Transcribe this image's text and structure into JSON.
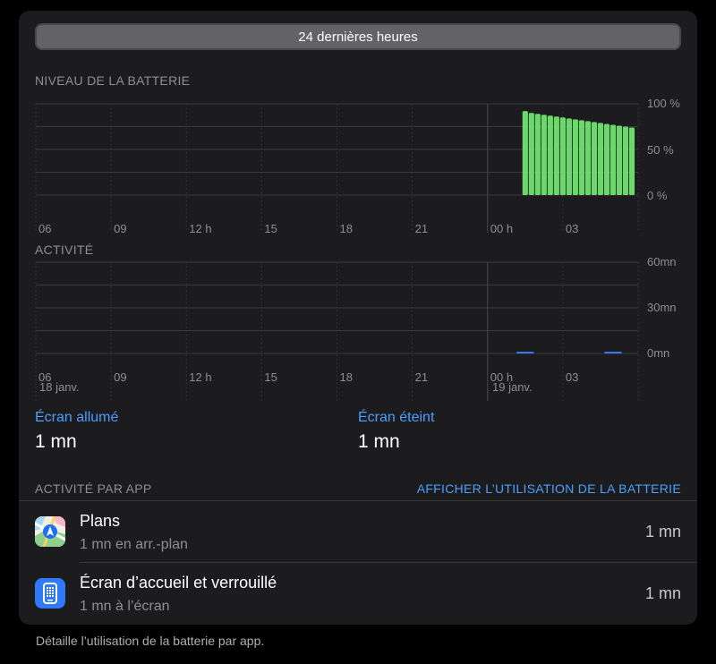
{
  "segment": {
    "label": "24 dernières heures"
  },
  "battery": {
    "title": "NIVEAU DE LA BATTERIE",
    "y_labels": [
      "100 %",
      "50 %",
      "0 %"
    ],
    "x_labels": [
      "06",
      "09",
      "12 h",
      "15",
      "18",
      "21",
      "00 h",
      "03"
    ]
  },
  "activity": {
    "title": "ACTIVITÉ",
    "y_labels": [
      "60mn",
      "30mn",
      "0mn"
    ],
    "x_labels": [
      "06",
      "09",
      "12 h",
      "15",
      "18",
      "21",
      "00 h",
      "03"
    ],
    "date_labels": [
      "18 janv.",
      "19 janv."
    ]
  },
  "stats": {
    "screen_on_label": "Écran allumé",
    "screen_on_value": "1 mn",
    "screen_off_label": "Écran éteint",
    "screen_off_value": "1 mn"
  },
  "apps": {
    "header": "ACTIVITÉ PAR APP",
    "show_usage": "AFFICHER L’UTILISATION DE LA BATTERIE",
    "items": [
      {
        "name": "Plans",
        "detail": "1 mn en arr.-plan",
        "time": "1 mn",
        "icon": "maps-icon"
      },
      {
        "name": "Écran d’accueil et verrouillé",
        "detail": "1 mn à l’écran",
        "time": "1 mn",
        "icon": "home-lock-screen-icon"
      }
    ]
  },
  "footer": "Détaille l’utilisation de la batterie par app.",
  "colors": {
    "accent": "#4a9fff",
    "battery_bar": "#6ad86a",
    "activity_line": "#3478f6",
    "card_bg": "#1c1c1e"
  },
  "chart_data": [
    {
      "type": "bar",
      "title": "NIVEAU DE LA BATTERIE",
      "x_unit": "hours_since_06h",
      "x_ticks": [
        0,
        3,
        6,
        9,
        12,
        15,
        18,
        21
      ],
      "x_tick_labels": [
        "06",
        "09",
        "12 h",
        "15",
        "18",
        "21",
        "00 h",
        "03"
      ],
      "x_range": [
        0,
        24
      ],
      "ylim": [
        0,
        100
      ],
      "y_ticks": [
        0,
        50,
        100
      ],
      "y_tick_labels": [
        "0 %",
        "50 %",
        "100 %"
      ],
      "grid": true,
      "bar_width_hours": 0.22,
      "x": [
        19.5,
        19.75,
        20.0,
        20.25,
        20.5,
        20.75,
        21.0,
        21.25,
        21.5,
        21.75,
        22.0,
        22.25,
        22.5,
        22.75,
        23.0,
        23.25,
        23.5,
        23.75
      ],
      "values": [
        92,
        90,
        89,
        88,
        87,
        86,
        85,
        84,
        83,
        82,
        81,
        80,
        79,
        78,
        77,
        76,
        75,
        74
      ]
    },
    {
      "type": "bar",
      "title": "ACTIVITÉ",
      "x_unit": "hours_since_06h",
      "x_ticks": [
        0,
        3,
        6,
        9,
        12,
        15,
        18,
        21
      ],
      "x_tick_labels": [
        "06",
        "09",
        "12 h",
        "15",
        "18",
        "21",
        "00 h",
        "03"
      ],
      "x_range": [
        0,
        24
      ],
      "ylim": [
        0,
        60
      ],
      "y_ticks": [
        0,
        30,
        60
      ],
      "y_tick_labels": [
        "0mn",
        "30mn",
        "60mn"
      ],
      "grid": true,
      "bar_width_hours": 0.7,
      "x": [
        19.5,
        23.0
      ],
      "values": [
        1,
        1
      ]
    }
  ]
}
